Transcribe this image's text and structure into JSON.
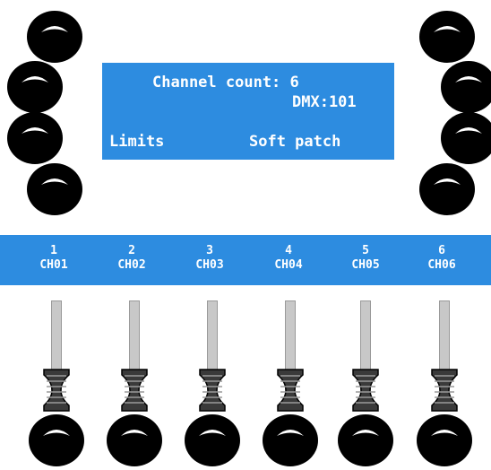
{
  "display": {
    "line1": "Channel count:  6",
    "line2": "DMX:101",
    "left_softkey": "Limits",
    "right_softkey": "Soft patch"
  },
  "channels": [
    {
      "number": "1",
      "name": "CH01"
    },
    {
      "number": "2",
      "name": "CH02"
    },
    {
      "number": "3",
      "name": "CH03"
    },
    {
      "number": "4",
      "name": "CH04"
    },
    {
      "number": "5",
      "name": "CH05"
    },
    {
      "number": "6",
      "name": "CH06"
    }
  ],
  "colors": {
    "lcd_blue": "#2d8ce0",
    "knob": "#000000",
    "text": "#ffffff"
  }
}
